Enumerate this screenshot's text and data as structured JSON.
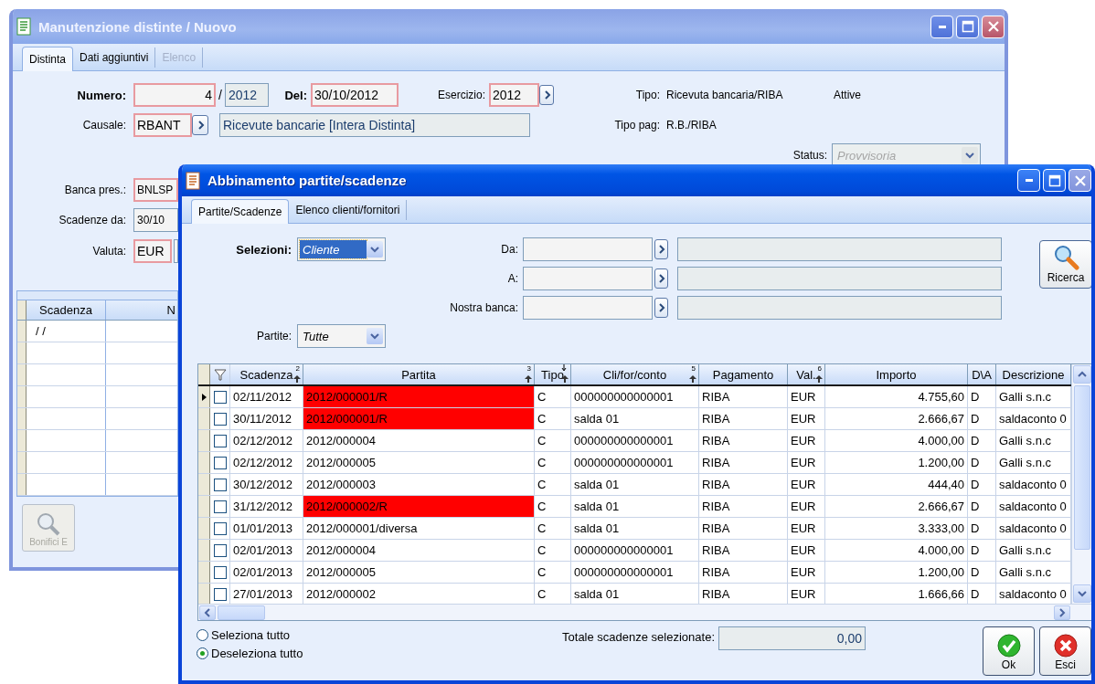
{
  "main_window": {
    "title": "Manutenzione distinte / Nuovo",
    "active": false,
    "tabs": [
      {
        "label": "Distinta",
        "selected": true,
        "disabled": false
      },
      {
        "label": "Dati aggiuntivi",
        "selected": false,
        "disabled": false
      },
      {
        "label": "Elenco",
        "selected": false,
        "disabled": true
      }
    ],
    "numero": {
      "label": "Numero:",
      "value": "4",
      "separator": "/",
      "year": "2012",
      "required": true
    },
    "del": {
      "label": "Del:",
      "value": "30/10/2012",
      "required": true
    },
    "esercizio": {
      "label": "Esercizio:",
      "value": "2012",
      "required": true
    },
    "tipo": {
      "label": "Tipo:",
      "value": "Ricevuta bancaria/RIBA",
      "direction": "Attive"
    },
    "causale": {
      "label": "Causale:",
      "value": "RBANT",
      "description": "Ricevute bancarie [Intera Distinta]",
      "required": true
    },
    "tipo_pag": {
      "label": "Tipo pag:",
      "value": "R.B./RIBA"
    },
    "status": {
      "label": "Status:",
      "value": "Provvisoria",
      "disabled": true
    },
    "banca_pres": {
      "label": "Banca pres.:",
      "value": "BNLSP",
      "required": true
    },
    "scadenze_da": {
      "label": "Scadenze da:",
      "value": "30/10",
      "required": false
    },
    "valuta": {
      "label": "Valuta:",
      "value": "EUR",
      "required": true
    },
    "table": {
      "columns": [
        "Scadenza",
        "N"
      ],
      "rows": [
        {
          "scadenza": "/ /"
        }
      ]
    },
    "button": {
      "label": "Bonifici E",
      "disabled": true
    }
  },
  "dialog": {
    "title": "Abbinamento partite/scadenze",
    "active": true,
    "tabs": [
      {
        "label": "Partite/Scadenze",
        "selected": true,
        "disabled": false
      },
      {
        "label": "Elenco clienti/fornitori",
        "selected": false,
        "disabled": false
      }
    ],
    "selezioni": {
      "label": "Selezioni:",
      "value": "Cliente",
      "focused": true
    },
    "filters": [
      {
        "label": "Da:"
      },
      {
        "label": "A:"
      },
      {
        "label": "Nostra banca:"
      }
    ],
    "search_button": {
      "label": "Ricerca"
    },
    "partite": {
      "label": "Partite:",
      "value": "Tutte",
      "focused": false
    },
    "grid": {
      "columns": [
        {
          "label": "Scadenza",
          "sort_mark": "2"
        },
        {
          "label": "Partita",
          "sort_mark": "3"
        },
        {
          "label": "Tipo",
          "sort_arrow": true
        },
        {
          "label": "Cli/for/conto",
          "sort_mark": "5"
        },
        {
          "label": "Pagamento"
        },
        {
          "label": "Val.",
          "sort_mark": "6"
        },
        {
          "label": "Importo"
        },
        {
          "label": "D\\A"
        },
        {
          "label": "Descrizione"
        }
      ],
      "rows": [
        {
          "current": true,
          "checked": false,
          "scadenza": "02/11/2012",
          "partita": "2012/000001/R",
          "flagged": true,
          "tipo": "C",
          "conto": "000000000000001",
          "pagamento": "RIBA",
          "valuta": "EUR",
          "importo": "4.755,60",
          "dare_avere": "D",
          "descrizione": "Galli s.n.c"
        },
        {
          "current": false,
          "checked": false,
          "scadenza": "30/11/2012",
          "partita": "2012/000001/R",
          "flagged": true,
          "tipo": "C",
          "conto": "salda 01",
          "pagamento": "RIBA",
          "valuta": "EUR",
          "importo": "2.666,67",
          "dare_avere": "D",
          "descrizione": "saldaconto 0"
        },
        {
          "current": false,
          "checked": false,
          "scadenza": "02/12/2012",
          "partita": "2012/000004",
          "flagged": false,
          "tipo": "C",
          "conto": "000000000000001",
          "pagamento": "RIBA",
          "valuta": "EUR",
          "importo": "4.000,00",
          "dare_avere": "D",
          "descrizione": "Galli s.n.c"
        },
        {
          "current": false,
          "checked": false,
          "scadenza": "02/12/2012",
          "partita": "2012/000005",
          "flagged": false,
          "tipo": "C",
          "conto": "000000000000001",
          "pagamento": "RIBA",
          "valuta": "EUR",
          "importo": "1.200,00",
          "dare_avere": "D",
          "descrizione": "Galli s.n.c"
        },
        {
          "current": false,
          "checked": false,
          "scadenza": "30/12/2012",
          "partita": "2012/000003",
          "flagged": false,
          "tipo": "C",
          "conto": "salda 01",
          "pagamento": "RIBA",
          "valuta": "EUR",
          "importo": "444,40",
          "dare_avere": "D",
          "descrizione": "saldaconto 0"
        },
        {
          "current": false,
          "checked": false,
          "scadenza": "31/12/2012",
          "partita": "2012/000002/R",
          "flagged": true,
          "tipo": "C",
          "conto": "salda 01",
          "pagamento": "RIBA",
          "valuta": "EUR",
          "importo": "2.666,67",
          "dare_avere": "D",
          "descrizione": "saldaconto 0"
        },
        {
          "current": false,
          "checked": false,
          "scadenza": "01/01/2013",
          "partita": "2012/000001/diversa",
          "flagged": false,
          "tipo": "C",
          "conto": "salda 01",
          "pagamento": "RIBA",
          "valuta": "EUR",
          "importo": "3.333,00",
          "dare_avere": "D",
          "descrizione": "saldaconto 0"
        },
        {
          "current": false,
          "checked": false,
          "scadenza": "02/01/2013",
          "partita": "2012/000004",
          "flagged": false,
          "tipo": "C",
          "conto": "000000000000001",
          "pagamento": "RIBA",
          "valuta": "EUR",
          "importo": "4.000,00",
          "dare_avere": "D",
          "descrizione": "Galli s.n.c"
        },
        {
          "current": false,
          "checked": false,
          "scadenza": "02/01/2013",
          "partita": "2012/000005",
          "flagged": false,
          "tipo": "C",
          "conto": "000000000000001",
          "pagamento": "RIBA",
          "valuta": "EUR",
          "importo": "1.200,00",
          "dare_avere": "D",
          "descrizione": "Galli s.n.c"
        },
        {
          "current": false,
          "checked": false,
          "scadenza": "27/01/2013",
          "partita": "2012/000002",
          "flagged": false,
          "tipo": "C",
          "conto": "salda 01",
          "pagamento": "RIBA",
          "valuta": "EUR",
          "importo": "1.666,66",
          "dare_avere": "D",
          "descrizione": "saldaconto 0"
        }
      ]
    },
    "selection_options": [
      {
        "label": "Seleziona tutto",
        "selected": false
      },
      {
        "label": "Deseleziona tutto",
        "selected": true
      }
    ],
    "totale": {
      "label": "Totale scadenze selezionate:",
      "value": "0,00"
    },
    "buttons": [
      {
        "kind": "ok",
        "label": "Ok"
      },
      {
        "kind": "cancel",
        "label": "Esci"
      }
    ]
  }
}
